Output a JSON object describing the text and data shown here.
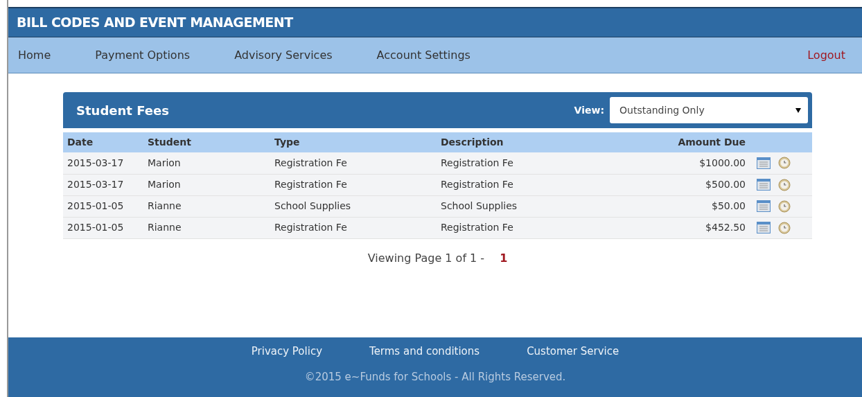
{
  "header": {
    "title": "BILL CODES AND EVENT MANAGEMENT"
  },
  "nav": {
    "items": [
      {
        "label": "Home"
      },
      {
        "label": "Payment Options"
      },
      {
        "label": "Advisory Services"
      },
      {
        "label": "Account Settings"
      }
    ],
    "logout": "Logout"
  },
  "panel": {
    "title": "Student Fees",
    "view_label": "View:",
    "view_value": "Outstanding Only"
  },
  "table": {
    "columns": [
      "Date",
      "Student",
      "Type",
      "Description",
      "Amount Due"
    ],
    "rows": [
      {
        "date": "2015-03-17",
        "student": "Marion",
        "type": "Registration Fe",
        "description": "Registration Fe",
        "amount": "$1000.00"
      },
      {
        "date": "2015-03-17",
        "student": "Marion",
        "type": "Registration Fe",
        "description": "Registration Fe",
        "amount": "$500.00"
      },
      {
        "date": "2015-01-05",
        "student": "Rianne",
        "type": "School Supplies",
        "description": "School Supplies",
        "amount": "$50.00"
      },
      {
        "date": "2015-01-05",
        "student": "Rianne",
        "type": "Registration Fe",
        "description": "Registration Fe",
        "amount": "$452.50"
      }
    ]
  },
  "pagination": {
    "text": "Viewing Page 1 of 1 -",
    "pages": [
      {
        "label": "1",
        "selected": true
      }
    ]
  },
  "footer": {
    "links": [
      "Privacy Policy",
      "Terms and conditions",
      "Customer Service"
    ],
    "copyright": "©2015 e~Funds for Schools - All Rights Reserved."
  }
}
